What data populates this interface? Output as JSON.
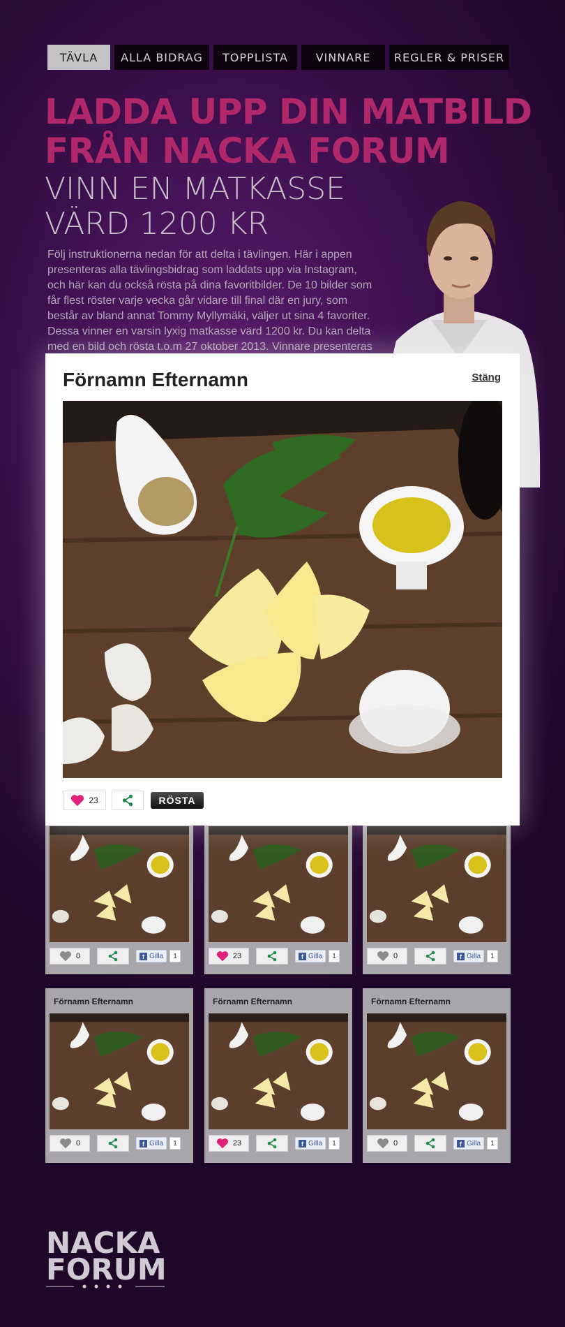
{
  "nav": {
    "tabs": [
      {
        "label": "TÄVLA",
        "active": true
      },
      {
        "label": "ALLA BIDRAG",
        "active": false
      },
      {
        "label": "TOPPLISTA",
        "active": false
      },
      {
        "label": "VINNARE",
        "active": false
      },
      {
        "label": "REGLER & PRISER",
        "active": false
      }
    ]
  },
  "hero": {
    "headline_line1": "LADDA UPP DIN MATBILD",
    "headline_line2": "FRÅN NACKA FORUM",
    "subhead_line1": "VINN EN MATKASSE",
    "subhead_line2": "VÄRD 1200 KR",
    "intro": "Följ instruktionerna nedan för att delta i tävlingen. Här i appen presenteras alla tävlingsbidrag som laddats upp via Instagram, och här kan du också rösta på dina favoritbilder. De 10 bilder som får flest röster varje vecka går vidare till final där en jury, som består av bland annat Tommy Myllymäki, väljer ut sina 4 favoriter. Dessa vinner en varsin lyxig matkasse värd 1200 kr. Du kan delta med en bild och rösta t.o.m 27 oktober 2013. Vinnare presenteras varje"
  },
  "modal": {
    "title": "Förnamn Efternamn",
    "close_label": "Stäng",
    "likes": "23",
    "vote_label": "RÖSTA"
  },
  "grid": {
    "row1": [
      {
        "likes": "0",
        "liked": false,
        "fb_label": "Gilla",
        "fb_count": "1"
      },
      {
        "likes": "23",
        "liked": true,
        "fb_label": "Gilla",
        "fb_count": "1"
      },
      {
        "likes": "0",
        "liked": false,
        "fb_label": "Gilla",
        "fb_count": "1"
      }
    ],
    "row2": [
      {
        "name": "Förnamn Efternamn",
        "likes": "0",
        "liked": false,
        "fb_label": "Gilla",
        "fb_count": "1"
      },
      {
        "name": "Förnamn Efternamn",
        "likes": "23",
        "liked": true,
        "fb_label": "Gilla",
        "fb_count": "1"
      },
      {
        "name": "Förnamn Efternamn",
        "likes": "0",
        "liked": false,
        "fb_label": "Gilla",
        "fb_count": "1"
      }
    ]
  },
  "footer": {
    "logo_line1": "NACKA",
    "logo_line2": "FORUM"
  },
  "colors": {
    "accent": "#b1286a",
    "background": "#3e1050",
    "heart_active": "#e0227a",
    "share_green": "#1f8a4c"
  }
}
